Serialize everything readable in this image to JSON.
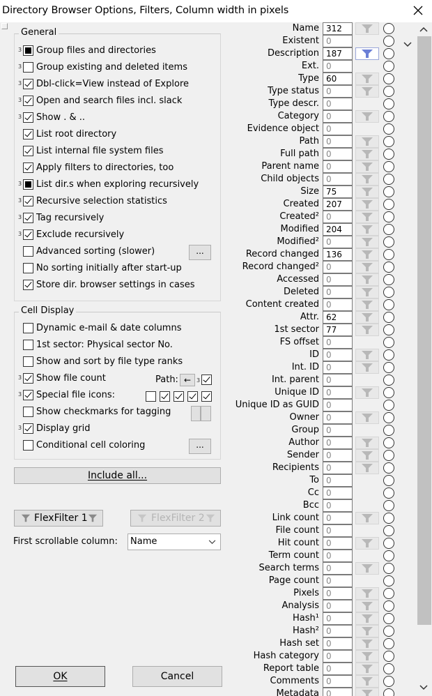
{
  "window": {
    "title": "Directory Browser Options, Filters, Column width in pixels",
    "close_icon": "close-icon"
  },
  "general": {
    "legend": "General",
    "items": [
      {
        "label": "Group files and directories",
        "state": "ind",
        "tri": true
      },
      {
        "label": "Group existing and deleted items",
        "state": "off",
        "tri": true
      },
      {
        "label": "Dbl-click=View instead of Explore",
        "state": "on",
        "tri": true
      },
      {
        "label": "Open and search files incl. slack",
        "state": "on",
        "tri": true
      },
      {
        "label": "Show . & ..",
        "state": "on",
        "tri": true
      },
      {
        "label": "List root directory",
        "state": "on",
        "tri": false
      },
      {
        "label": "List internal file system files",
        "state": "on",
        "tri": false
      },
      {
        "label": "Apply filters to directories, too",
        "state": "on",
        "tri": false
      },
      {
        "label": "List dir.s when exploring recursively",
        "state": "ind",
        "tri": true
      },
      {
        "label": "Recursive selection statistics",
        "state": "on",
        "tri": true
      },
      {
        "label": "Tag recursively",
        "state": "on",
        "tri": true
      },
      {
        "label": "Exclude recursively",
        "state": "on",
        "tri": true
      },
      {
        "label": "Advanced sorting (slower)",
        "state": "off",
        "tri": false,
        "dots": "..."
      },
      {
        "label": "No sorting initially after start-up",
        "state": "off",
        "tri": false
      },
      {
        "label": "Store dir. browser settings in cases",
        "state": "on",
        "tri": false
      }
    ]
  },
  "cell_display": {
    "legend": "Cell Display",
    "items": [
      {
        "label": "Dynamic e-mail & date columns",
        "state": "off",
        "tri": false
      },
      {
        "label": "1st sector: Physical sector No.",
        "state": "off",
        "tri": false
      },
      {
        "label": "Show and sort by file type ranks",
        "state": "off",
        "tri": false
      },
      {
        "label": "Show file count",
        "state": "on",
        "tri": true
      },
      {
        "label": "Special file icons:",
        "state": "on",
        "tri": true
      },
      {
        "label": "Show checkmarks for tagging",
        "state": "off",
        "tri": false
      },
      {
        "label": "Display grid",
        "state": "on",
        "tri": true
      },
      {
        "label": "Conditional cell coloring",
        "state": "off",
        "tri": false,
        "dots": "..."
      }
    ],
    "path_label": "Path:",
    "path_arrow": "←",
    "special_icons": [
      "off",
      "on",
      "on",
      "on",
      "on"
    ]
  },
  "include_all": "Include all...",
  "flexfilter1": "FlexFilter 1",
  "flexfilter2": "FlexFilter 2",
  "first_col_label": "First scrollable column:",
  "first_col_value": "Name",
  "ok": "OK",
  "cancel": "Cancel",
  "columns": [
    {
      "name": "Name",
      "value": "312",
      "filter": "gray"
    },
    {
      "name": "Existent",
      "value": "0",
      "filter": "none"
    },
    {
      "name": "Description",
      "value": "187",
      "filter": "blue"
    },
    {
      "name": "Ext.",
      "value": "0",
      "filter": "none"
    },
    {
      "name": "Type",
      "value": "60",
      "filter": "gray"
    },
    {
      "name": "Type status",
      "value": "0",
      "filter": "gray"
    },
    {
      "name": "Type descr.",
      "value": "0",
      "filter": "none"
    },
    {
      "name": "Category",
      "value": "0",
      "filter": "gray"
    },
    {
      "name": "Evidence object",
      "value": "0",
      "filter": "none"
    },
    {
      "name": "Path",
      "value": "0",
      "filter": "gray"
    },
    {
      "name": "Full path",
      "value": "0",
      "filter": "gray"
    },
    {
      "name": "Parent name",
      "value": "0",
      "filter": "gray"
    },
    {
      "name": "Child objects",
      "value": "0",
      "filter": "gray"
    },
    {
      "name": "Size",
      "value": "75",
      "filter": "gray"
    },
    {
      "name": "Created",
      "value": "207",
      "filter": "gray"
    },
    {
      "name": "Created²",
      "value": "0",
      "filter": "gray"
    },
    {
      "name": "Modified",
      "value": "204",
      "filter": "gray"
    },
    {
      "name": "Modified²",
      "value": "0",
      "filter": "gray"
    },
    {
      "name": "Record changed",
      "value": "136",
      "filter": "gray"
    },
    {
      "name": "Record changed²",
      "value": "0",
      "filter": "gray"
    },
    {
      "name": "Accessed",
      "value": "0",
      "filter": "gray"
    },
    {
      "name": "Deleted",
      "value": "0",
      "filter": "gray"
    },
    {
      "name": "Content created",
      "value": "0",
      "filter": "gray"
    },
    {
      "name": "Attr.",
      "value": "62",
      "filter": "gray"
    },
    {
      "name": "1st sector",
      "value": "77",
      "filter": "gray"
    },
    {
      "name": "FS offset",
      "value": "0",
      "filter": "none"
    },
    {
      "name": "ID",
      "value": "0",
      "filter": "gray"
    },
    {
      "name": "Int. ID",
      "value": "0",
      "filter": "gray"
    },
    {
      "name": "Int. parent",
      "value": "0",
      "filter": "none"
    },
    {
      "name": "Unique ID",
      "value": "0",
      "filter": "gray"
    },
    {
      "name": "Unique ID as GUID",
      "value": "0",
      "filter": "none"
    },
    {
      "name": "Owner",
      "value": "0",
      "filter": "gray"
    },
    {
      "name": "Group",
      "value": "0",
      "filter": "none"
    },
    {
      "name": "Author",
      "value": "0",
      "filter": "gray"
    },
    {
      "name": "Sender",
      "value": "0",
      "filter": "gray"
    },
    {
      "name": "Recipients",
      "value": "0",
      "filter": "gray"
    },
    {
      "name": "To",
      "value": "0",
      "filter": "none"
    },
    {
      "name": "Cc",
      "value": "0",
      "filter": "none"
    },
    {
      "name": "Bcc",
      "value": "0",
      "filter": "none"
    },
    {
      "name": "Link count",
      "value": "0",
      "filter": "gray"
    },
    {
      "name": "File count",
      "value": "0",
      "filter": "none"
    },
    {
      "name": "Hit count",
      "value": "0",
      "filter": "gray"
    },
    {
      "name": "Term count",
      "value": "0",
      "filter": "none"
    },
    {
      "name": "Search terms",
      "value": "0",
      "filter": "gray"
    },
    {
      "name": "Page count",
      "value": "0",
      "filter": "none"
    },
    {
      "name": "Pixels",
      "value": "0",
      "filter": "gray"
    },
    {
      "name": "Analysis",
      "value": "0",
      "filter": "gray"
    },
    {
      "name": "Hash¹",
      "value": "0",
      "filter": "gray"
    },
    {
      "name": "Hash²",
      "value": "0",
      "filter": "gray"
    },
    {
      "name": "Hash set",
      "value": "0",
      "filter": "gray"
    },
    {
      "name": "Hash category",
      "value": "0",
      "filter": "gray"
    },
    {
      "name": "Report table",
      "value": "0",
      "filter": "gray"
    },
    {
      "name": "Comments",
      "value": "0",
      "filter": "gray"
    },
    {
      "name": "Metadata",
      "value": "0",
      "filter": "gray"
    }
  ]
}
